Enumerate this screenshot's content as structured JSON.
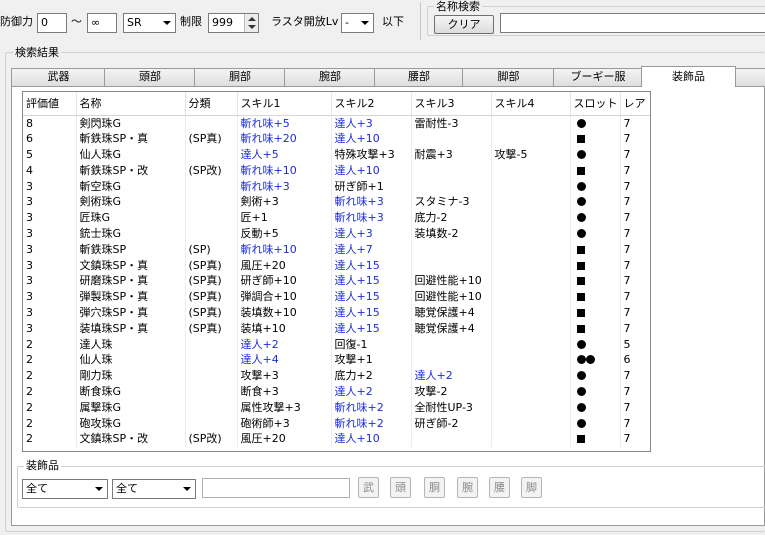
{
  "filters": {
    "defense_label": "防御力",
    "defense_min": "0",
    "range_sep": "～",
    "defense_max": "∞",
    "rarity_value": "SR",
    "limit_label": "制限",
    "limit_value": "999",
    "rasta_label": "ラスタ開放Lv",
    "rasta_value": "-",
    "rasta_suffix": "以下"
  },
  "name_search": {
    "group_label": "名称検索",
    "clear_label": "クリア",
    "input_value": ""
  },
  "results": {
    "group_label": "検索結果",
    "tabs": [
      "武器",
      "頭部",
      "胴部",
      "腕部",
      "腰部",
      "脚部",
      "ブーギー服",
      "装飾品",
      "ス"
    ],
    "active_tab": "装飾品"
  },
  "table": {
    "columns": [
      "評価値",
      "名称",
      "分類",
      "スキル1",
      "スキル2",
      "スキル3",
      "スキル4",
      "スロット",
      "レア"
    ],
    "rows": [
      {
        "score": "8",
        "name": "剣閃珠G",
        "cat": "",
        "s1": "斬れ味+5",
        "s1b": true,
        "s2": "達人+3",
        "s2b": true,
        "s3": "雷耐性-3",
        "s3b": false,
        "s4": "",
        "s4b": false,
        "slot": "dot1",
        "rare": "7"
      },
      {
        "score": "6",
        "name": "斬鉄珠SP・真",
        "cat": "(SP真)",
        "s1": "斬れ味+20",
        "s1b": true,
        "s2": "達人+10",
        "s2b": true,
        "s3": "",
        "s3b": false,
        "s4": "",
        "s4b": false,
        "slot": "sq",
        "rare": "7"
      },
      {
        "score": "5",
        "name": "仙人珠G",
        "cat": "",
        "s1": "達人+5",
        "s1b": true,
        "s2": "特殊攻撃+3",
        "s2b": false,
        "s3": "耐震+3",
        "s3b": false,
        "s4": "攻撃-5",
        "s4b": false,
        "slot": "dot1",
        "rare": "7"
      },
      {
        "score": "4",
        "name": "斬鉄珠SP・改",
        "cat": "(SP改)",
        "s1": "斬れ味+10",
        "s1b": true,
        "s2": "達人+10",
        "s2b": true,
        "s3": "",
        "s3b": false,
        "s4": "",
        "s4b": false,
        "slot": "sq",
        "rare": "7"
      },
      {
        "score": "3",
        "name": "斬空珠G",
        "cat": "",
        "s1": "斬れ味+3",
        "s1b": true,
        "s2": "研ぎ師+1",
        "s2b": false,
        "s3": "",
        "s3b": false,
        "s4": "",
        "s4b": false,
        "slot": "dot1",
        "rare": "7"
      },
      {
        "score": "3",
        "name": "剣術珠G",
        "cat": "",
        "s1": "剣術+3",
        "s1b": false,
        "s2": "斬れ味+3",
        "s2b": true,
        "s3": "スタミナ-3",
        "s3b": false,
        "s4": "",
        "s4b": false,
        "slot": "dot1",
        "rare": "7"
      },
      {
        "score": "3",
        "name": "匠珠G",
        "cat": "",
        "s1": "匠+1",
        "s1b": false,
        "s2": "斬れ味+3",
        "s2b": true,
        "s3": "底力-2",
        "s3b": false,
        "s4": "",
        "s4b": false,
        "slot": "dot1",
        "rare": "7"
      },
      {
        "score": "3",
        "name": "銃士珠G",
        "cat": "",
        "s1": "反動+5",
        "s1b": false,
        "s2": "達人+3",
        "s2b": true,
        "s3": "装填数-2",
        "s3b": false,
        "s4": "",
        "s4b": false,
        "slot": "dot1",
        "rare": "7"
      },
      {
        "score": "3",
        "name": "斬鉄珠SP",
        "cat": "(SP)",
        "s1": "斬れ味+10",
        "s1b": true,
        "s2": "達人+7",
        "s2b": true,
        "s3": "",
        "s3b": false,
        "s4": "",
        "s4b": false,
        "slot": "sq",
        "rare": "7"
      },
      {
        "score": "3",
        "name": "文鎮珠SP・真",
        "cat": "(SP真)",
        "s1": "風圧+20",
        "s1b": false,
        "s2": "達人+15",
        "s2b": true,
        "s3": "",
        "s3b": false,
        "s4": "",
        "s4b": false,
        "slot": "sq",
        "rare": "7"
      },
      {
        "score": "3",
        "name": "研磨珠SP・真",
        "cat": "(SP真)",
        "s1": "研ぎ師+10",
        "s1b": false,
        "s2": "達人+15",
        "s2b": true,
        "s3": "回避性能+10",
        "s3b": false,
        "s4": "",
        "s4b": false,
        "slot": "sq",
        "rare": "7"
      },
      {
        "score": "3",
        "name": "弾製珠SP・真",
        "cat": "(SP真)",
        "s1": "弾調合+10",
        "s1b": false,
        "s2": "達人+15",
        "s2b": true,
        "s3": "回避性能+10",
        "s3b": false,
        "s4": "",
        "s4b": false,
        "slot": "sq",
        "rare": "7"
      },
      {
        "score": "3",
        "name": "弾穴珠SP・真",
        "cat": "(SP真)",
        "s1": "装填数+10",
        "s1b": false,
        "s2": "達人+15",
        "s2b": true,
        "s3": "聴覚保護+4",
        "s3b": false,
        "s4": "",
        "s4b": false,
        "slot": "sq",
        "rare": "7"
      },
      {
        "score": "3",
        "name": "装填珠SP・真",
        "cat": "(SP真)",
        "s1": "装填+10",
        "s1b": false,
        "s2": "達人+15",
        "s2b": true,
        "s3": "聴覚保護+4",
        "s3b": false,
        "s4": "",
        "s4b": false,
        "slot": "sq",
        "rare": "7"
      },
      {
        "score": "2",
        "name": "達人珠",
        "cat": "",
        "s1": "達人+2",
        "s1b": true,
        "s2": "回復-1",
        "s2b": false,
        "s3": "",
        "s3b": false,
        "s4": "",
        "s4b": false,
        "slot": "dot1",
        "rare": "5"
      },
      {
        "score": "2",
        "name": "仙人珠",
        "cat": "",
        "s1": "達人+4",
        "s1b": true,
        "s2": "攻撃+1",
        "s2b": false,
        "s3": "",
        "s3b": false,
        "s4": "",
        "s4b": false,
        "slot": "dot2",
        "rare": "6"
      },
      {
        "score": "2",
        "name": "剛力珠",
        "cat": "",
        "s1": "攻撃+3",
        "s1b": false,
        "s2": "底力+2",
        "s2b": false,
        "s3": "達人+2",
        "s3b": true,
        "s4": "",
        "s4b": false,
        "slot": "dot1",
        "rare": "7"
      },
      {
        "score": "2",
        "name": "断食珠G",
        "cat": "",
        "s1": "断食+3",
        "s1b": false,
        "s2": "達人+2",
        "s2b": true,
        "s3": "攻撃-2",
        "s3b": false,
        "s4": "",
        "s4b": false,
        "slot": "dot1",
        "rare": "7"
      },
      {
        "score": "2",
        "name": "属撃珠G",
        "cat": "",
        "s1": "属性攻撃+3",
        "s1b": false,
        "s2": "斬れ味+2",
        "s2b": true,
        "s3": "全耐性UP-3",
        "s3b": false,
        "s4": "",
        "s4b": false,
        "slot": "dot1",
        "rare": "7"
      },
      {
        "score": "2",
        "name": "砲攻珠G",
        "cat": "",
        "s1": "砲術師+3",
        "s1b": false,
        "s2": "斬れ味+2",
        "s2b": true,
        "s3": "研ぎ師-2",
        "s3b": false,
        "s4": "",
        "s4b": false,
        "slot": "dot1",
        "rare": "7"
      },
      {
        "score": "2",
        "name": "文鎮珠SP・改",
        "cat": "(SP改)",
        "s1": "風圧+20",
        "s1b": false,
        "s2": "達人+10",
        "s2b": true,
        "s3": "",
        "s3b": false,
        "s4": "",
        "s4b": false,
        "slot": "sq",
        "rare": "7"
      }
    ]
  },
  "bottom": {
    "group_label": "装飾品",
    "select1_value": "全て",
    "select2_value": "全て",
    "input_value": "",
    "part_buttons": [
      "武",
      "頭",
      "胴",
      "腕",
      "腰",
      "脚"
    ]
  }
}
